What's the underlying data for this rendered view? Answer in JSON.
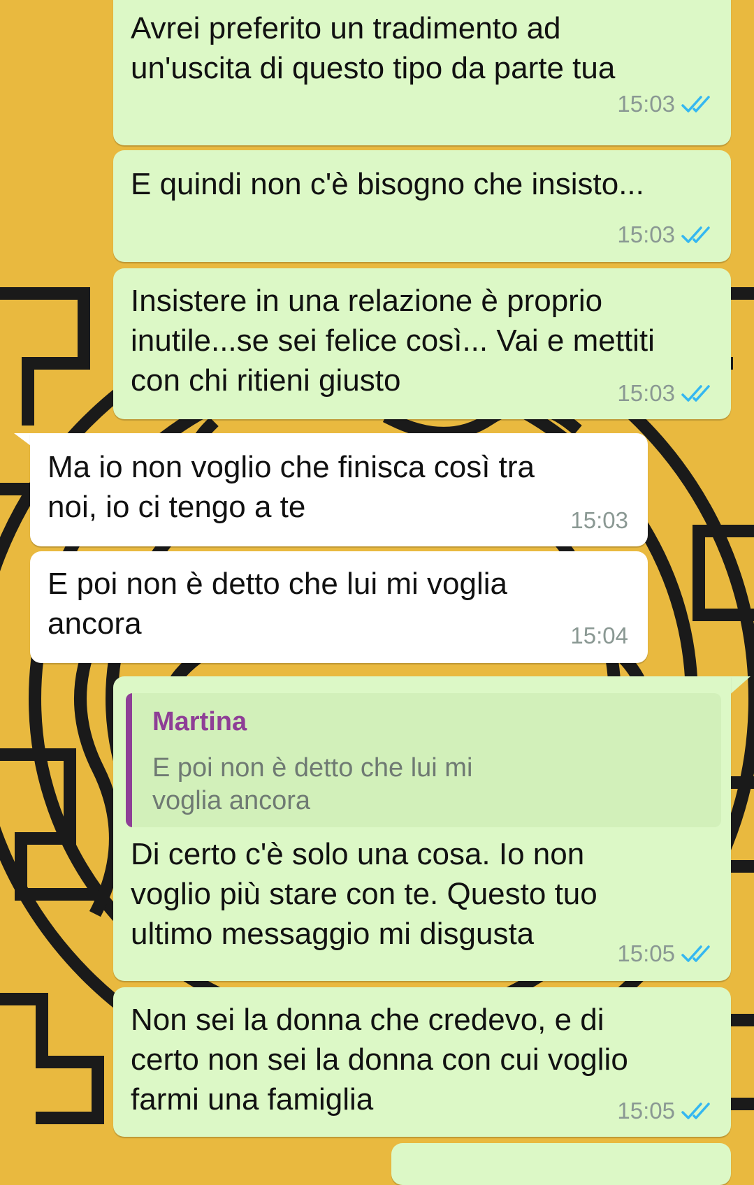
{
  "chat": {
    "colors": {
      "outgoing_bg": "#DCF8C6",
      "incoming_bg": "#FFFFFF",
      "read_tick": "#34B7F1",
      "quote_author": "#8E3E96",
      "wallpaper": "#E9B93F"
    },
    "messages": [
      {
        "direction": "outgoing",
        "text": "Avrei preferito un tradimento ad\nun'uscita di questo tipo da parte tua",
        "time": "15:03",
        "status_icon": "double-check-read-icon"
      },
      {
        "direction": "outgoing",
        "text": "E quindi non c'è bisogno che insisto...",
        "time": "15:03",
        "status_icon": "double-check-read-icon"
      },
      {
        "direction": "outgoing",
        "text": "Insistere in una relazione è proprio\ninutile...se sei felice così... Vai e mettiti\ncon chi ritieni giusto",
        "time": "15:03",
        "status_icon": "double-check-read-icon"
      },
      {
        "direction": "incoming",
        "text": "Ma io non voglio che finisca così tra\nnoi, io ci tengo a te",
        "time": "15:03"
      },
      {
        "direction": "incoming",
        "text": "E poi non è detto che lui mi voglia\nancora",
        "time": "15:04"
      },
      {
        "direction": "outgoing",
        "quoted": {
          "author": "Martina",
          "text": "E poi non è detto che lui mi\nvoglia ancora"
        },
        "text": "Di certo c'è solo una cosa. Io non\nvoglio più stare con te. Questo tuo\nultimo messaggio mi disgusta",
        "time": "15:05",
        "status_icon": "double-check-read-icon"
      },
      {
        "direction": "outgoing",
        "text": "Non sei la donna che credevo, e di\ncerto non sei la donna con cui voglio\nfarmi una famiglia",
        "time": "15:05",
        "status_icon": "double-check-read-icon"
      }
    ]
  }
}
